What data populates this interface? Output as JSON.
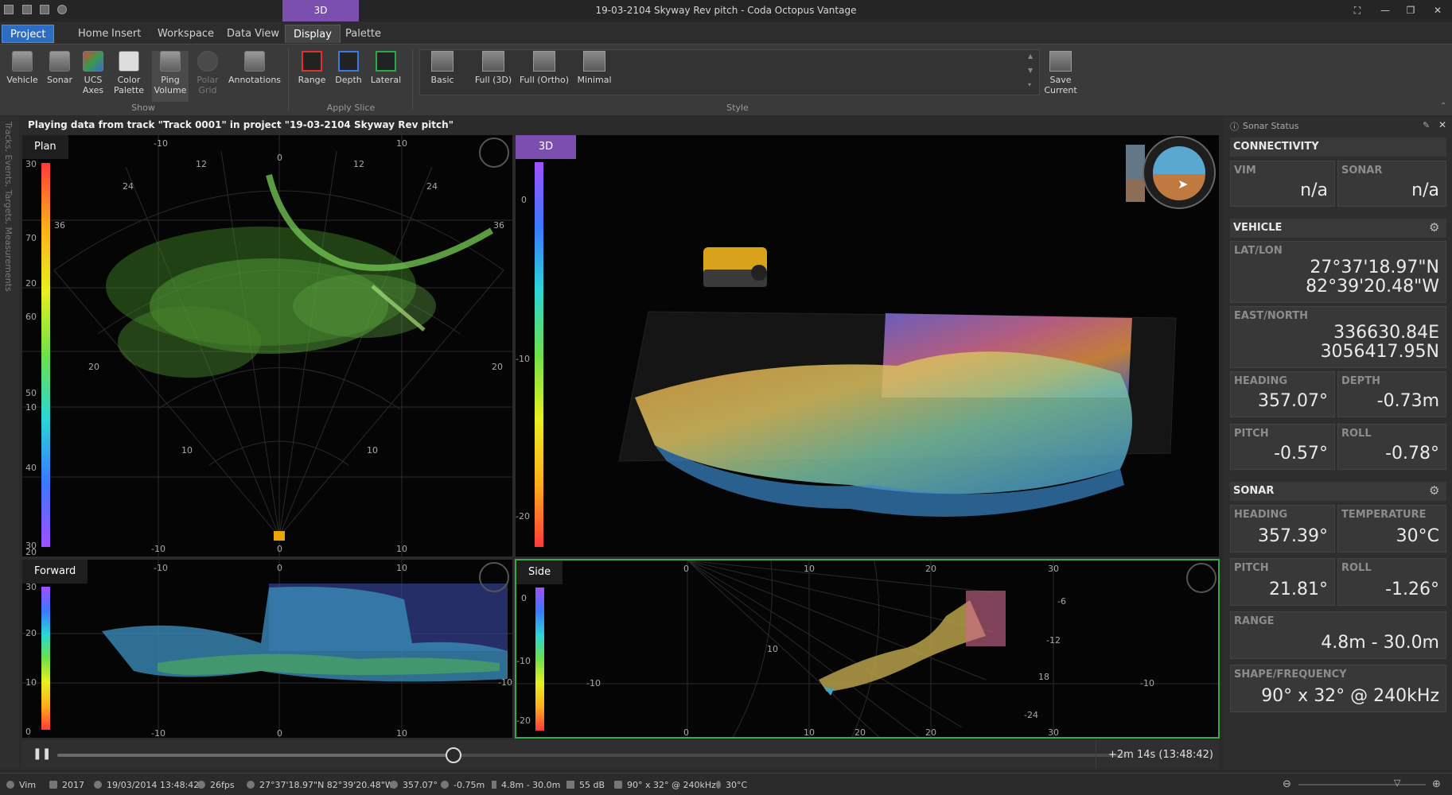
{
  "window": {
    "title": "19-03-2104 Skyway Rev pitch - Coda Octopus Vantage",
    "context_tab": "3D"
  },
  "tabs": [
    "Project",
    "Home",
    "Insert",
    "Workspace",
    "Data View",
    "Display",
    "Palette"
  ],
  "ribbon": {
    "show_buttons": [
      "Vehicle",
      "Sonar",
      "UCS\nAxes",
      "Color\nPalette",
      "Ping\nVolume",
      "Polar\nGrid",
      "Annotations"
    ],
    "show_group": "Show",
    "slice_buttons": [
      "Range",
      "Depth",
      "Lateral"
    ],
    "slice_group": "Apply Slice",
    "style_buttons": [
      "Basic",
      "Full (3D)",
      "Full (Ortho)",
      "Minimal"
    ],
    "style_group": "Style",
    "save_button": "Save\nCurrent"
  },
  "info_bar": "Playing  data from track \"Track 0001\" in project \"19-03-2104 Skyway Rev pitch\"",
  "left_strip": "Tracks, Events, Targets, Measurements",
  "panels": {
    "plan": {
      "label": "Plan"
    },
    "threed": {
      "label": "3D"
    },
    "forward": {
      "label": "Forward"
    },
    "side": {
      "label": "Side"
    }
  },
  "plan_ticks": {
    "top": [
      "-10",
      "0",
      "10"
    ],
    "bottom": [
      "-10",
      "0",
      "10"
    ],
    "left": [
      "30",
      "70",
      "20",
      "60",
      "50",
      "10",
      "40",
      "30",
      "20"
    ],
    "arcs": [
      "12",
      "24",
      "36",
      "12",
      "24",
      "36",
      "20",
      "10",
      "10",
      "20"
    ]
  },
  "threed_ticks": [
    "0",
    "-10",
    "-20"
  ],
  "forward_ticks": {
    "top": [
      "-10",
      "0",
      "10"
    ],
    "bottom": [
      "-10",
      "0",
      "10"
    ],
    "left": [
      "30",
      "20",
      "10",
      "0"
    ],
    "right": [
      "-10"
    ]
  },
  "side_ticks": {
    "top": [
      "0",
      "10",
      "20",
      "30"
    ],
    "bottom": [
      "0",
      "10",
      "20",
      "30"
    ],
    "left": [
      "0",
      "-10",
      "-20"
    ],
    "right": [
      "-6",
      "-12",
      "18",
      "-24"
    ],
    "sides": [
      "-10",
      "-10"
    ],
    "arcs": [
      "10",
      "20"
    ]
  },
  "playback": {
    "time": "+2m 14s (13:48:42)",
    "progress": 0.37
  },
  "sonar_status": {
    "title": "Sonar Status",
    "connectivity": {
      "header": "CONNECTIVITY",
      "vim_label": "VIM",
      "vim": "n/a",
      "sonar_label": "SONAR",
      "sonar": "n/a"
    },
    "vehicle": {
      "header": "VEHICLE",
      "latlon_label": "LAT/LON",
      "lat": "27°37'18.97\"N",
      "lon": "82°39'20.48\"W",
      "eastnorth_label": "EAST/NORTH",
      "east": "336630.84E",
      "north": "3056417.95N",
      "heading_label": "HEADING",
      "heading": "357.07°",
      "depth_label": "DEPTH",
      "depth": "-0.73m",
      "pitch_label": "PITCH",
      "pitch": "-0.57°",
      "roll_label": "ROLL",
      "roll": "-0.78°"
    },
    "sonar": {
      "header": "SONAR",
      "heading_label": "HEADING",
      "heading": "357.39°",
      "temp_label": "TEMPERATURE",
      "temp": "30°C",
      "pitch_label": "PITCH",
      "pitch": "21.81°",
      "roll_label": "ROLL",
      "roll": "-1.26°",
      "range_label": "RANGE",
      "range": "4.8m - 30.0m",
      "shape_label": "SHAPE/FREQUENCY",
      "shape": "90° x 32° @ 240kHz"
    }
  },
  "status_bar": {
    "vim": "Vim",
    "year": "2017",
    "datetime": "19/03/2014 13:48:42",
    "fps": "26fps",
    "position": "27°37'18.97\"N 82°39'20.48\"W",
    "heading": "357.07°",
    "depth": "-0.75m",
    "range": "4.8m - 30.0m",
    "gain": "55 dB",
    "shape": "90° x 32° @ 240kHz",
    "temp": "30°C"
  },
  "colors": {
    "accent": "#2d6dc2",
    "context": "#7a4fb0",
    "side_border": "#3aa84a"
  }
}
